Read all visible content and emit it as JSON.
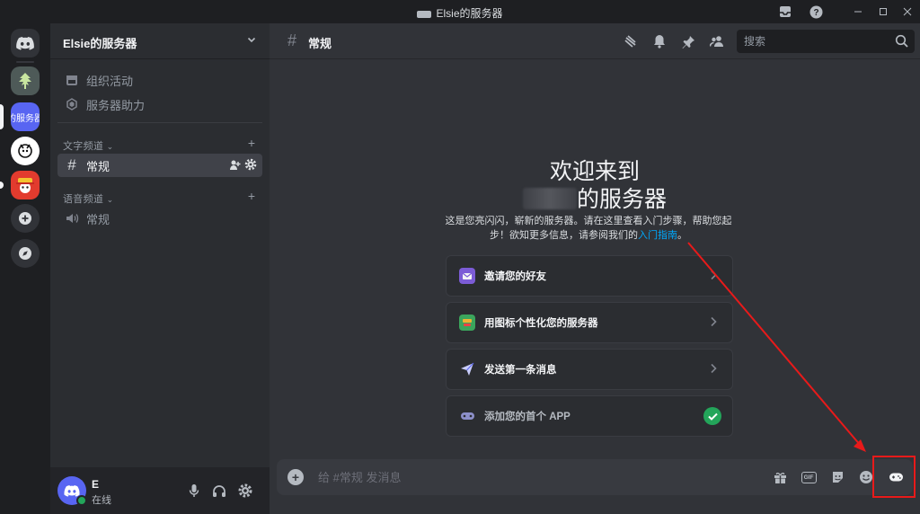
{
  "window": {
    "title": "Elsie的服务器"
  },
  "server_list": {
    "selected_label": "的服务器"
  },
  "sidebar": {
    "server_name": "Elsie的服务器",
    "top_items": [
      {
        "label": "组织活动",
        "icon": "calendar-icon"
      },
      {
        "label": "服务器助力",
        "icon": "boost-icon"
      }
    ],
    "text_category": "文字频道",
    "text_channels": [
      {
        "label": "常规",
        "active": true
      }
    ],
    "voice_category": "语音频道",
    "voice_channels": [
      {
        "label": "常规"
      }
    ]
  },
  "user": {
    "name": "E",
    "status": "在线"
  },
  "channel_header": {
    "name": "常规",
    "search_placeholder": "搜索"
  },
  "welcome": {
    "line1": "欢迎来到",
    "line2_suffix": "的服务器",
    "description_pre": "这是您亮闪闪，崭新的服务器。请在这里查看入门步骤，帮助您起步！欲知更多信息，请参阅我们的",
    "description_link": "入门指南",
    "description_post": "。"
  },
  "cards": [
    {
      "label": "邀请您的好友",
      "icon": "invite-icon",
      "done": false
    },
    {
      "label": "用图标个性化您的服务器",
      "icon": "customize-icon",
      "done": false
    },
    {
      "label": "发送第一条消息",
      "icon": "send-icon",
      "done": false
    },
    {
      "label": "添加您的首个 APP",
      "icon": "app-icon",
      "done": true
    }
  ],
  "composer": {
    "placeholder": "给 #常规 发消息",
    "gif_label": "GIF"
  },
  "colors": {
    "accent": "#5865f2",
    "online": "#23a55a",
    "highlight": "#e81a1a",
    "link": "#00a8fc"
  }
}
